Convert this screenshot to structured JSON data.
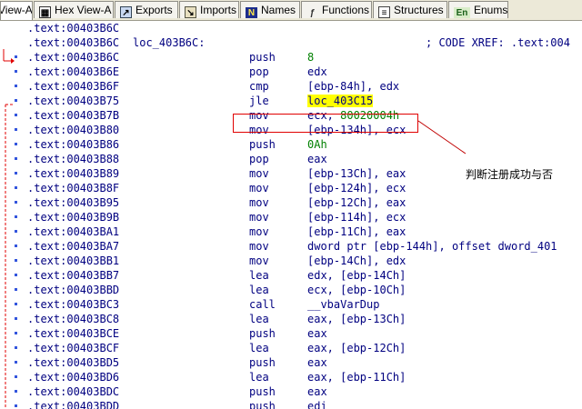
{
  "tabs": [
    {
      "label": "View-A",
      "icon": "ida-view-icon",
      "active": true
    },
    {
      "label": "Hex View-A",
      "icon": "hex-view-icon",
      "active": false
    },
    {
      "label": "Exports",
      "icon": "exports-icon",
      "active": false
    },
    {
      "label": "Imports",
      "icon": "imports-icon",
      "active": false
    },
    {
      "label": "Names",
      "icon": "names-icon",
      "active": false
    },
    {
      "label": "Functions",
      "icon": "functions-icon",
      "active": false
    },
    {
      "label": "Structures",
      "icon": "structures-icon",
      "active": false
    },
    {
      "label": "Enums",
      "icon": "enums-icon",
      "active": false
    }
  ],
  "listing": [
    {
      "addr": ".text:00403B6C",
      "label": "",
      "mnem": "",
      "op": "",
      "comment": ""
    },
    {
      "addr": ".text:00403B6C",
      "label": "loc_403B6C:",
      "mnem": "",
      "op": "",
      "comment": "; CODE XREF: .text:004"
    },
    {
      "addr": ".text:00403B6C",
      "label": "",
      "mnem": "push",
      "op": "8",
      "comment": ""
    },
    {
      "addr": ".text:00403B6E",
      "label": "",
      "mnem": "pop",
      "op": "edx",
      "comment": ""
    },
    {
      "addr": ".text:00403B6F",
      "label": "",
      "mnem": "cmp",
      "op": "[ebp-84h], edx",
      "comment": ""
    },
    {
      "addr": ".text:00403B75",
      "label": "",
      "mnem": "jle",
      "op": "loc_403C15",
      "comment": ""
    },
    {
      "addr": ".text:00403B7B",
      "label": "",
      "mnem": "mov",
      "op": "ecx, 80020004h",
      "comment": ""
    },
    {
      "addr": ".text:00403B80",
      "label": "",
      "mnem": "mov",
      "op": "[ebp-134h], ecx",
      "comment": ""
    },
    {
      "addr": ".text:00403B86",
      "label": "",
      "mnem": "push",
      "op": "0Ah",
      "comment": ""
    },
    {
      "addr": ".text:00403B88",
      "label": "",
      "mnem": "pop",
      "op": "eax",
      "comment": ""
    },
    {
      "addr": ".text:00403B89",
      "label": "",
      "mnem": "mov",
      "op": "[ebp-13Ch], eax",
      "comment": ""
    },
    {
      "addr": ".text:00403B8F",
      "label": "",
      "mnem": "mov",
      "op": "[ebp-124h], ecx",
      "comment": ""
    },
    {
      "addr": ".text:00403B95",
      "label": "",
      "mnem": "mov",
      "op": "[ebp-12Ch], eax",
      "comment": ""
    },
    {
      "addr": ".text:00403B9B",
      "label": "",
      "mnem": "mov",
      "op": "[ebp-114h], ecx",
      "comment": ""
    },
    {
      "addr": ".text:00403BA1",
      "label": "",
      "mnem": "mov",
      "op": "[ebp-11Ch], eax",
      "comment": ""
    },
    {
      "addr": ".text:00403BA7",
      "label": "",
      "mnem": "mov",
      "op": "dword ptr [ebp-144h], offset dword_401",
      "comment": ""
    },
    {
      "addr": ".text:00403BB1",
      "label": "",
      "mnem": "mov",
      "op": "[ebp-14Ch], edx",
      "comment": ""
    },
    {
      "addr": ".text:00403BB7",
      "label": "",
      "mnem": "lea",
      "op": "edx, [ebp-14Ch]",
      "comment": ""
    },
    {
      "addr": ".text:00403BBD",
      "label": "",
      "mnem": "lea",
      "op": "ecx, [ebp-10Ch]",
      "comment": ""
    },
    {
      "addr": ".text:00403BC3",
      "label": "",
      "mnem": "call",
      "op": "__vbaVarDup",
      "comment": ""
    },
    {
      "addr": ".text:00403BC8",
      "label": "",
      "mnem": "lea",
      "op": "eax, [ebp-13Ch]",
      "comment": ""
    },
    {
      "addr": ".text:00403BCE",
      "label": "",
      "mnem": "push",
      "op": "eax",
      "comment": ""
    },
    {
      "addr": ".text:00403BCF",
      "label": "",
      "mnem": "lea",
      "op": "eax, [ebp-12Ch]",
      "comment": ""
    },
    {
      "addr": ".text:00403BD5",
      "label": "",
      "mnem": "push",
      "op": "eax",
      "comment": ""
    },
    {
      "addr": ".text:00403BD6",
      "label": "",
      "mnem": "lea",
      "op": "eax, [ebp-11Ch]",
      "comment": ""
    },
    {
      "addr": ".text:00403BDC",
      "label": "",
      "mnem": "push",
      "op": "eax",
      "comment": ""
    },
    {
      "addr": ".text:00403BDD",
      "label": "",
      "mnem": "push",
      "op": "edi",
      "comment": ""
    }
  ],
  "annotation": {
    "text": "判断注册成功与否"
  },
  "colors": {
    "code_text": "#000080",
    "number": "#008000",
    "highlight": "#ffff00",
    "callout": "#e00000",
    "flow_arrow": "#e00000",
    "dots": "#3355dd"
  }
}
